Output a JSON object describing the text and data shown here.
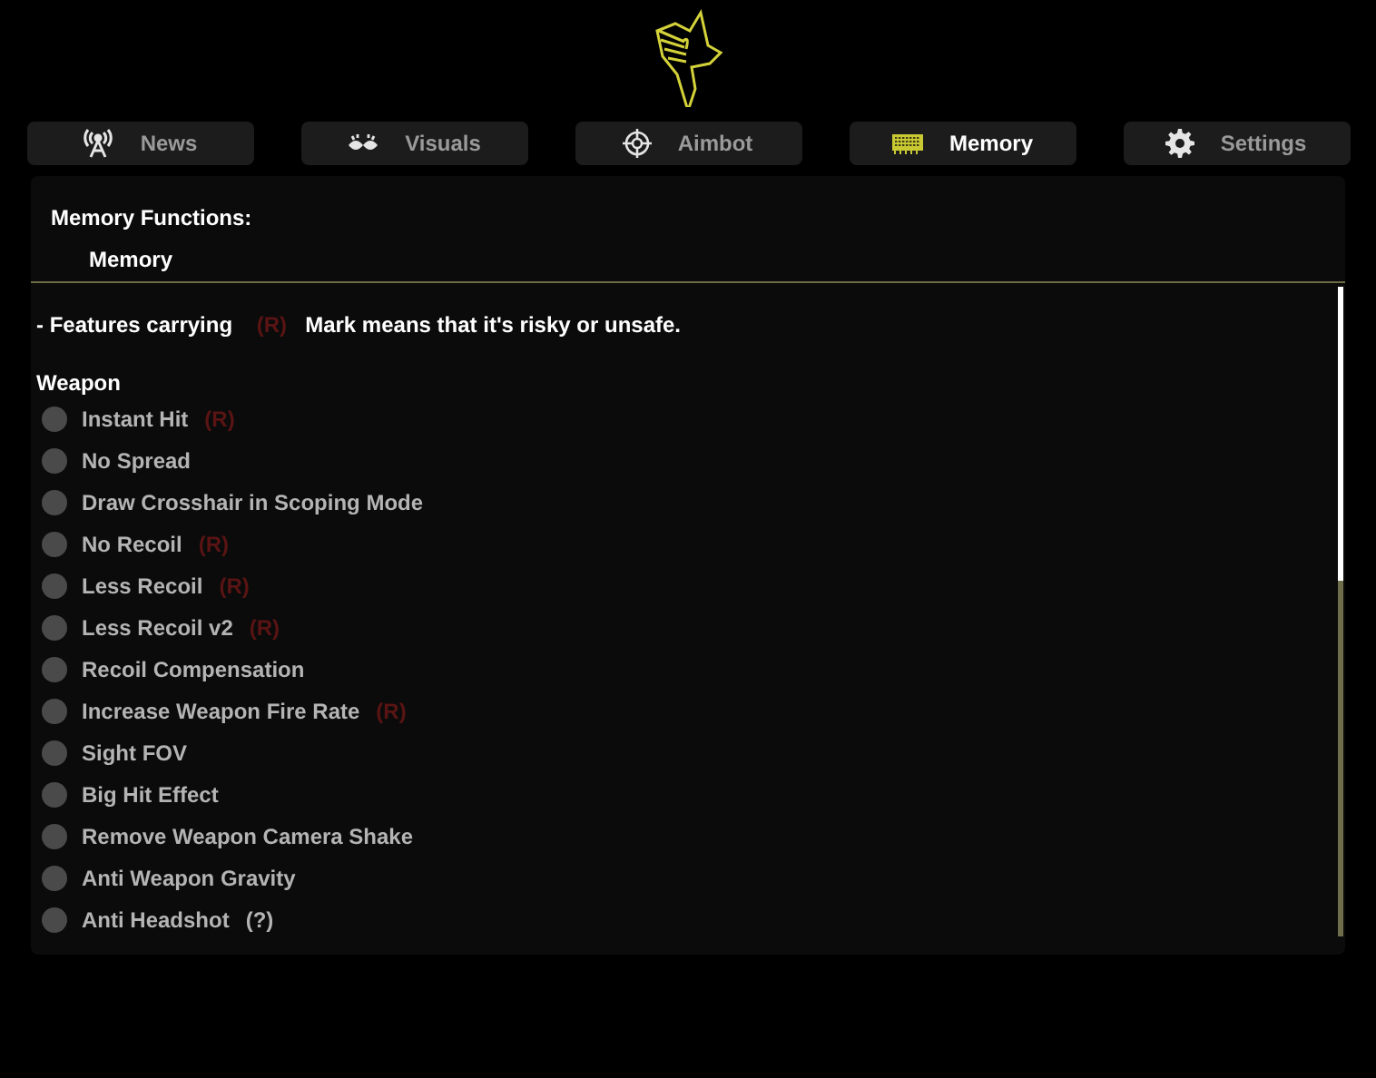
{
  "tabs": [
    {
      "label": "News",
      "selected": false
    },
    {
      "label": "Visuals",
      "selected": false
    },
    {
      "label": "Aimbot",
      "selected": false
    },
    {
      "label": "Memory",
      "selected": true
    },
    {
      "label": "Settings",
      "selected": false
    }
  ],
  "header": {
    "title": "Memory Functions:",
    "subtitle": "Memory"
  },
  "notice": {
    "prefix": "- Features carrying",
    "mark": "(R)",
    "suffix": "Mark means that it's risky or unsafe."
  },
  "section": "Weapon",
  "items": [
    {
      "label": "Instant Hit",
      "tag": {
        "text": "(R)",
        "color": "#5a1414"
      },
      "checked": false
    },
    {
      "label": "No Spread",
      "checked": false
    },
    {
      "label": "Draw Crosshair in Scoping Mode",
      "checked": false
    },
    {
      "label": "No Recoil",
      "tag": {
        "text": "(R)",
        "color": "#5a1414"
      },
      "checked": false
    },
    {
      "label": "Less Recoil",
      "tag": {
        "text": "(R)",
        "color": "#5a1414"
      },
      "checked": false
    },
    {
      "label": "Less Recoil v2",
      "tag": {
        "text": "(R)",
        "color": "#5a1414"
      },
      "checked": false
    },
    {
      "label": "Recoil Compensation",
      "checked": false
    },
    {
      "label": "Increase Weapon Fire Rate",
      "tag": {
        "text": "(R)",
        "color": "#5a1414"
      },
      "checked": false
    },
    {
      "label": "Sight FOV",
      "checked": false
    },
    {
      "label": "Big Hit Effect",
      "checked": false
    },
    {
      "label": "Remove Weapon Camera Shake",
      "checked": false
    },
    {
      "label": "Anti Weapon Gravity",
      "checked": false
    },
    {
      "label": "Anti Headshot",
      "tag": {
        "text": "(?)",
        "color": "#b4b4b4"
      },
      "checked": false
    }
  ]
}
